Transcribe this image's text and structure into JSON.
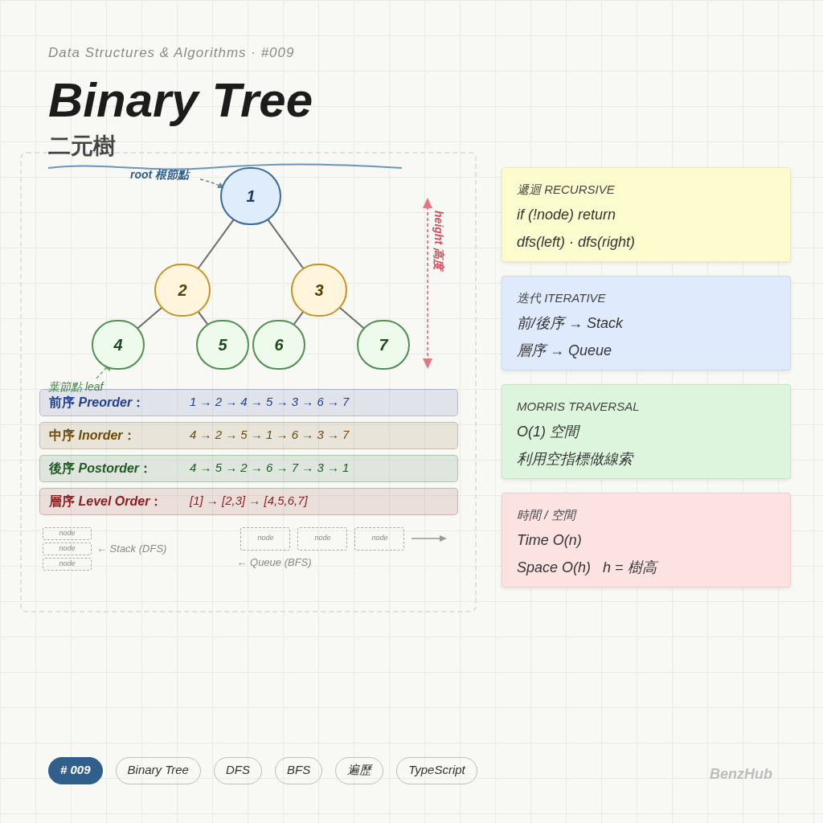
{
  "header": {
    "series": "Data Structures & Algorithms · #009",
    "title": "Binary Tree",
    "subtitle": "二元樹"
  },
  "diagram": {
    "tree": {
      "label": "1",
      "children": [
        {
          "label": "2",
          "children": [
            {
              "label": "4"
            },
            {
              "label": "5"
            }
          ]
        },
        {
          "label": "3",
          "children": [
            {
              "label": "6"
            },
            {
              "label": "7"
            }
          ]
        }
      ]
    },
    "root_note": "root 根節點",
    "leaf_note": "葉節點 leaf",
    "height_note": "height 高度",
    "traversals": [
      {
        "label": "前序 *Preorder*：",
        "sequence": "1 → 2 → 4 → 5 → 3 → 6 → 7",
        "color": "#23408e"
      },
      {
        "label": "中序 *Inorder*：",
        "sequence": "4 → 2 → 5 → 1 → 6 → 3 → 7",
        "color": "#6b4a0a"
      },
      {
        "label": "後序 *Postorder*：",
        "sequence": "4 → 5 → 2 → 6 → 7 → 3 → 1",
        "color": "#1f5a25"
      },
      {
        "label": "層序 *Level Order*：",
        "sequence": "[1] → [2,3] → [4,5,6,7]",
        "color": "#8b1e1e"
      }
    ],
    "stack": {
      "items": [
        "node",
        "node",
        "node"
      ],
      "label": "← Stack (DFS)"
    },
    "queue": {
      "items": [
        "node",
        "node",
        "node"
      ],
      "label": "← Queue (BFS)"
    }
  },
  "cards": [
    {
      "title": "遞迴 RECURSIVE",
      "lines": [
        "if (!node) return",
        "dfs(left) · dfs(right)"
      ],
      "color": "#fdfccf"
    },
    {
      "title": "迭代 ITERATIVE",
      "lines": [
        "前/後序 → Stack",
        "層序 → Queue"
      ],
      "color": "#dfeafc"
    },
    {
      "title": "MORRIS TRAVERSAL",
      "lines": [
        "O(1) 空間",
        "利用空指標做線索"
      ],
      "color": "#ddf5dc"
    },
    {
      "title": "時間 / 空間",
      "lines": [
        "Time O(n)",
        "Space O(h)   h = 樹高"
      ],
      "color": "#fde2e2"
    }
  ],
  "tags": [
    {
      "label": "# 009",
      "kind": "primary"
    },
    {
      "label": "Binary Tree",
      "kind": "outline"
    },
    {
      "label": "DFS",
      "kind": "outline"
    },
    {
      "label": "BFS",
      "kind": "outline"
    },
    {
      "label": "遍歷",
      "kind": "outline"
    },
    {
      "label": "TypeScript",
      "kind": "outline"
    }
  ],
  "brand": "BenzHub"
}
